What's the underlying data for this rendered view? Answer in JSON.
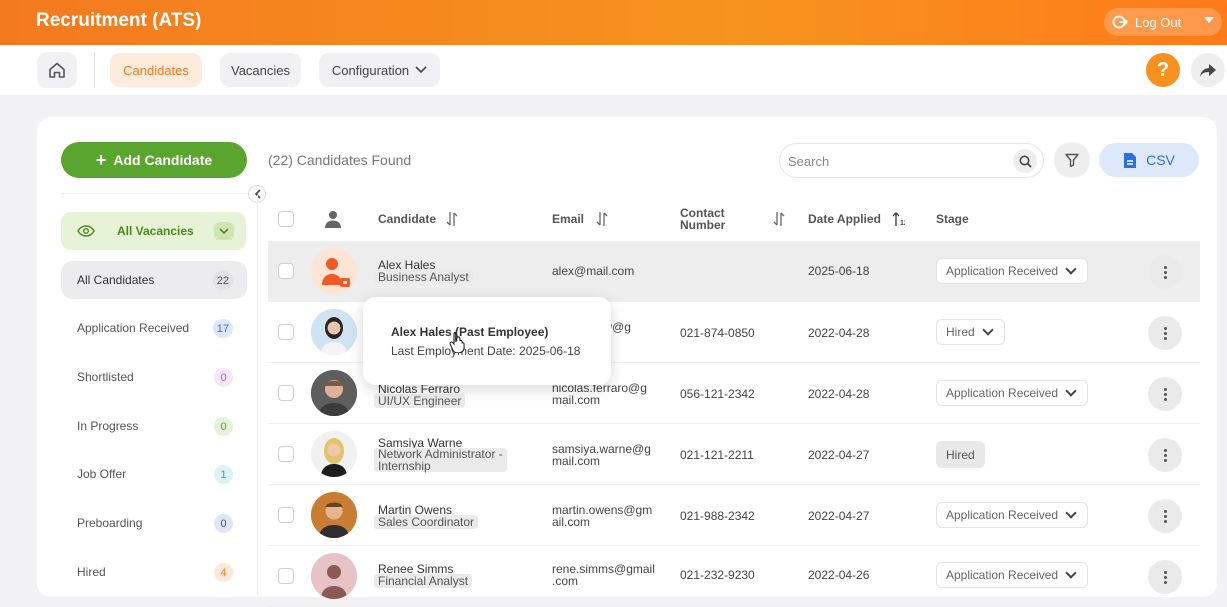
{
  "header": {
    "title": "Recruitment (ATS)",
    "logout_label": "Log Out"
  },
  "nav": {
    "candidates": "Candidates",
    "vacancies": "Vacancies",
    "configuration": "Configuration",
    "help": "?"
  },
  "toolbar": {
    "add_label": "Add Candidate",
    "found_text": "(22) Candidates Found",
    "search_placeholder": "Search",
    "csv_label": "CSV"
  },
  "sidebar": {
    "vacancy_filter": "All Vacancies",
    "stages": [
      {
        "label": "All Candidates",
        "count": "22"
      },
      {
        "label": "Application Received",
        "count": "17"
      },
      {
        "label": "Shortlisted",
        "count": "0"
      },
      {
        "label": "In Progress",
        "count": "0"
      },
      {
        "label": "Job Offer",
        "count": "1"
      },
      {
        "label": "Preboarding",
        "count": "0"
      },
      {
        "label": "Hired",
        "count": "4"
      }
    ]
  },
  "table": {
    "headers": {
      "candidate": "Candidate",
      "email": "Email",
      "contact_line1": "Contact",
      "contact_line2": "Number",
      "date": "Date Applied",
      "stage": "Stage"
    },
    "rows": [
      {
        "name": "Alex Hales",
        "role": "Business Analyst",
        "email1": "alex@mail.com",
        "email2": "",
        "phone": "",
        "date": "2025-06-18",
        "stage": "Application Received"
      },
      {
        "name": "",
        "role": "",
        "email1": "how@g",
        "email2": "",
        "phone": "021-874-0850",
        "date": "2022-04-28",
        "stage": "Hired"
      },
      {
        "name": "Nicolas Ferraro",
        "role": "UI/UX Engineer",
        "email1": "nicolas.ferraro@g",
        "email2": "mail.com",
        "phone": "056-121-2342",
        "date": "2022-04-28",
        "stage": "Application Received"
      },
      {
        "name": "Samsiya Warne",
        "role_line1": "Network Administrator -",
        "role_line2": "Internship",
        "email1": "samsiya.warne@g",
        "email2": "mail.com",
        "phone": "021-121-2211",
        "date": "2022-04-27",
        "stage": "Hired"
      },
      {
        "name": "Martin Owens",
        "role": "Sales Coordinator",
        "email1": "martin.owens@gm",
        "email2": "ail.com",
        "phone": "021-988-2342",
        "date": "2022-04-27",
        "stage": "Application Received"
      },
      {
        "name": "Renee Simms",
        "role": "Financial Analyst",
        "email1": "rene.simms@gmail",
        "email2": ".com",
        "phone": "021-232-9230",
        "date": "2022-04-26",
        "stage": "Application Received"
      }
    ]
  },
  "tooltip": {
    "title": "Alex Hales (Past Employee)",
    "subtitle": "Last Employment Date: 2025-06-18"
  },
  "colors": {
    "brand_orange": "#f47a1f",
    "green": "#5aa52e",
    "csv_blue": "#2f6fe0"
  }
}
